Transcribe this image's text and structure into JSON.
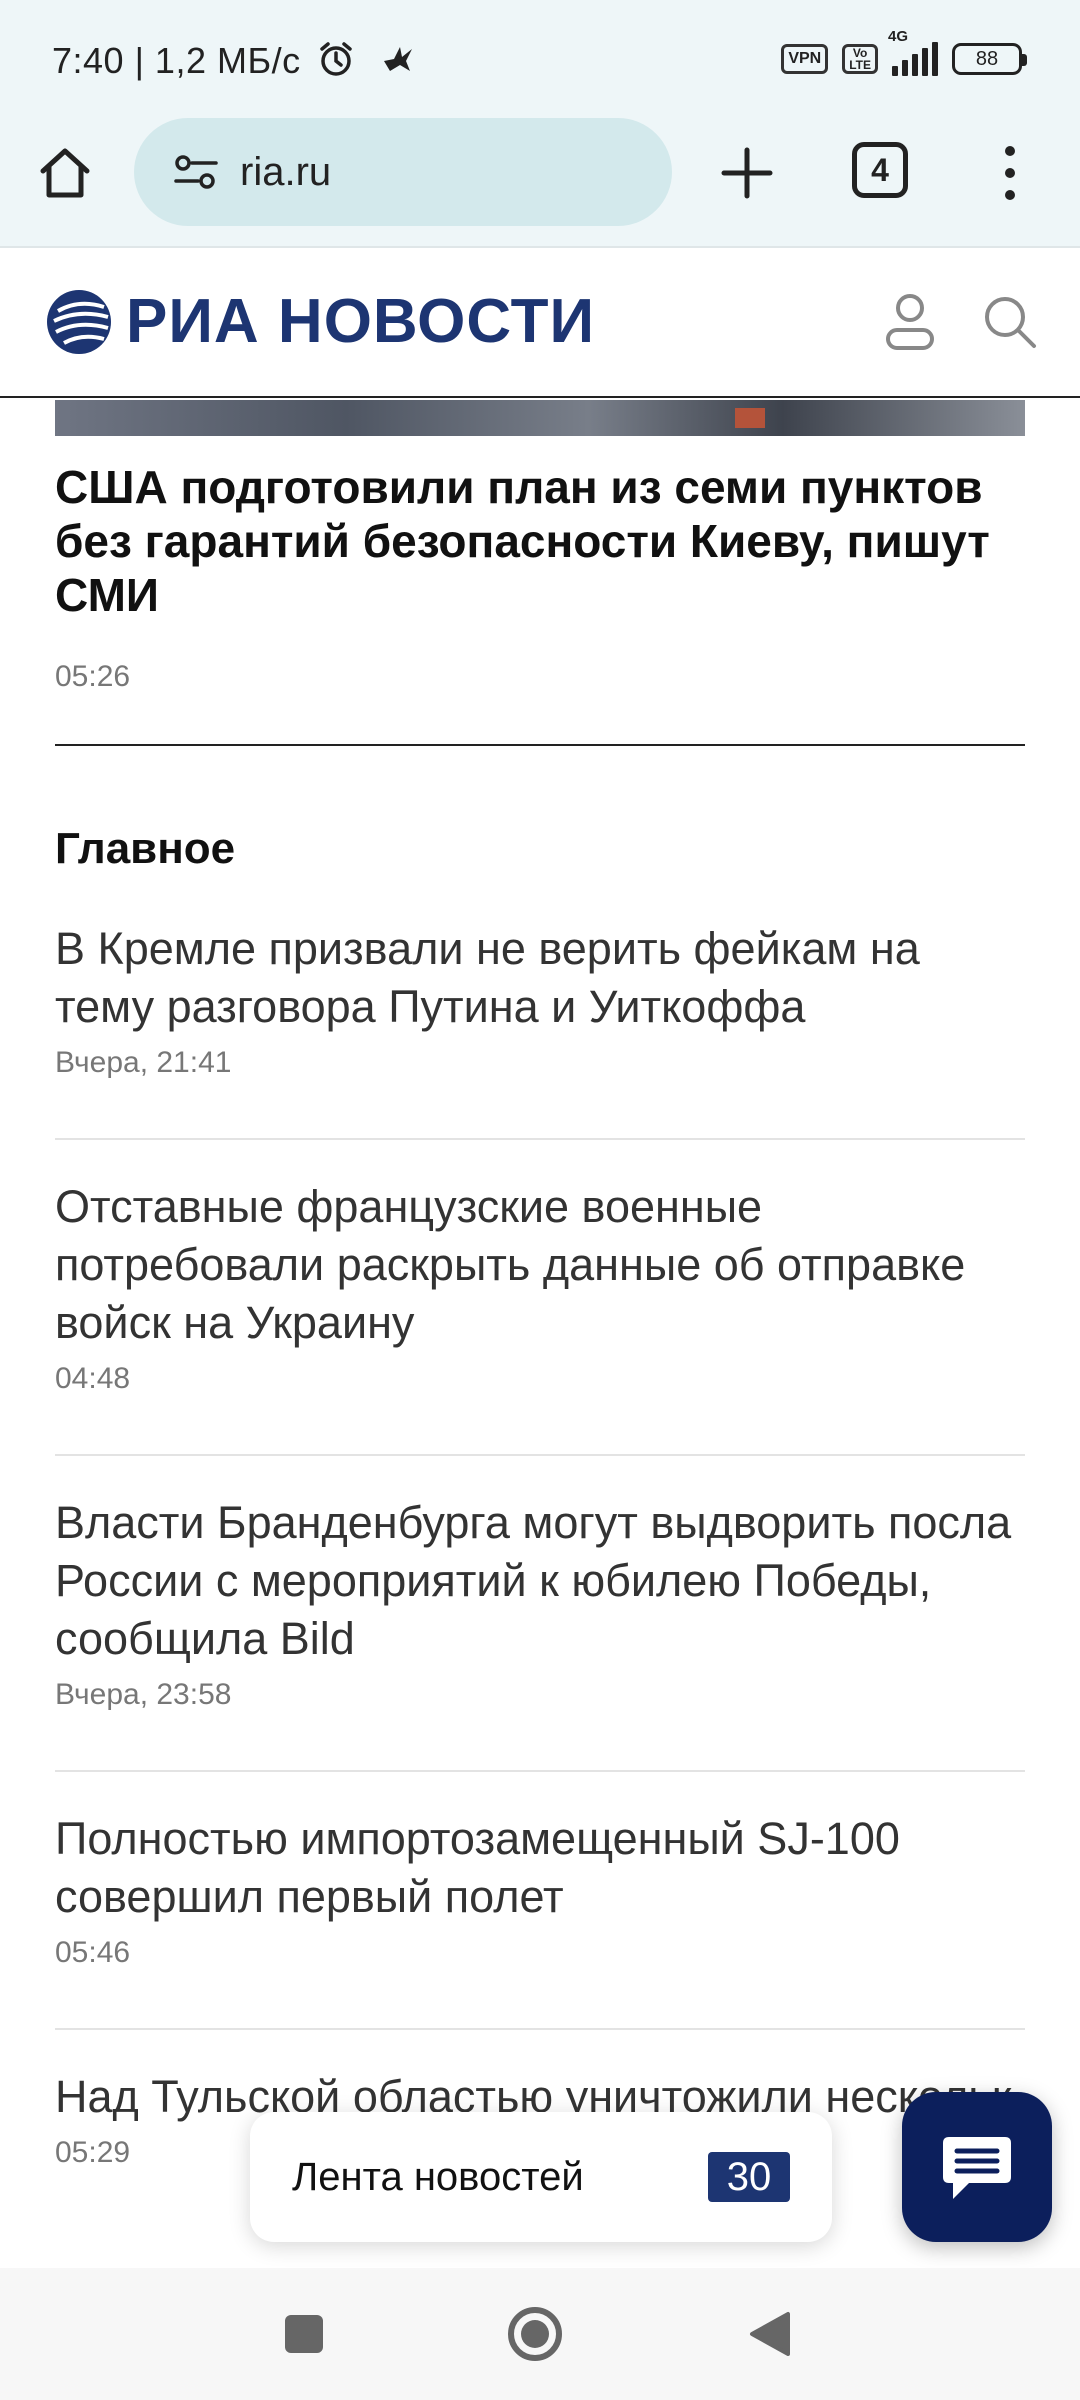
{
  "status_bar": {
    "text": "7:40 | 1,2 МБ/с",
    "vpn": "VPN",
    "volte_top": "Vo",
    "volte_bottom": "LTE",
    "network": "4G",
    "battery": "88"
  },
  "browser": {
    "url": "ria.ru",
    "tab_count": "4"
  },
  "site": {
    "logo_text": "РИА НОВОСТИ",
    "brand_color": "#1d3572"
  },
  "hero": {
    "title": "США подготовили план из семи пунктов без гарантий безопасности Киеву, пишут СМИ",
    "time": "05:26"
  },
  "section": {
    "title": "Главное"
  },
  "news": [
    {
      "title": "В Кремле призвали не верить фейкам на тему разговора Путина и Уиткоффа",
      "time": "Вчера, 21:41"
    },
    {
      "title": "Отставные французские военные потребовали раскрыть данные об отправке войск на Украину",
      "time": "04:48"
    },
    {
      "title": "Власти Бранденбурга могут выдворить посла России с мероприятий к юбилею Победы, сообщила Bild",
      "time": "Вчера, 23:58"
    },
    {
      "title": "Полностью импортозамещенный SJ-100 совершил первый полет",
      "time": "05:46"
    },
    {
      "title": "Над Тульской областью уничтожили нескольк",
      "time": "05:29"
    }
  ],
  "feed": {
    "label": "Лента новостей",
    "count": "30"
  }
}
